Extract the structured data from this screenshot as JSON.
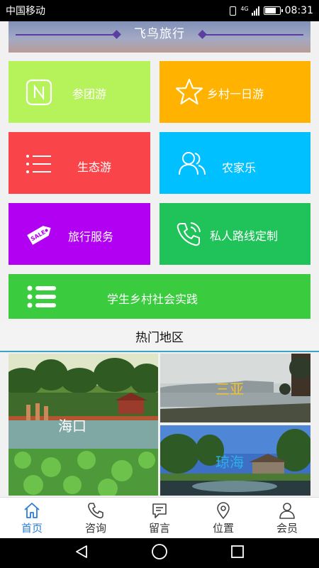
{
  "status": {
    "carrier": "中国移动",
    "time": "08:31",
    "network": "4G"
  },
  "banner": {
    "title": "飞鸟旅行"
  },
  "tiles": [
    {
      "label": "参团游",
      "color": "#b6f25a",
      "icon": "n-square-icon"
    },
    {
      "label": "乡村一日游",
      "color": "#ffb300",
      "icon": "star-icon"
    },
    {
      "label": "生态游",
      "color": "#f9454a",
      "icon": "list-icon"
    },
    {
      "label": "农家乐",
      "color": "#00c0ff",
      "icon": "users-icon"
    },
    {
      "label": "旅行服务",
      "color": "#b100f2",
      "icon": "sale-tag-icon",
      "tag_text": "SALE"
    },
    {
      "label": "私人路线定制",
      "color": "#1fc35a",
      "icon": "phone-icon"
    },
    {
      "label": "学生乡村社会实践",
      "color": "#3acb3e",
      "icon": "bullet-list-icon"
    }
  ],
  "hot": {
    "title": "热门地区",
    "regions": [
      {
        "name": "海口",
        "label_color": "#ffffff"
      },
      {
        "name": "三亚",
        "label_color": "#f2c230"
      },
      {
        "name": "琼海",
        "label_color": "#2bb0e6"
      }
    ]
  },
  "tabbar": [
    {
      "label": "首页",
      "icon": "home-icon",
      "active": true
    },
    {
      "label": "咨询",
      "icon": "phone-icon"
    },
    {
      "label": "留言",
      "icon": "message-icon"
    },
    {
      "label": "位置",
      "icon": "location-pin-icon"
    },
    {
      "label": "会员",
      "icon": "user-icon"
    }
  ]
}
